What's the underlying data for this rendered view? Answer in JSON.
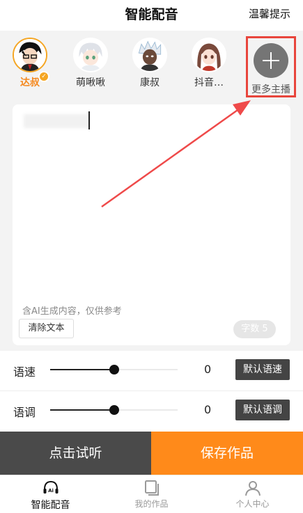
{
  "header": {
    "title": "智能配音",
    "tip": "温馨提示"
  },
  "anchors": [
    {
      "name": "达叔",
      "selected": true
    },
    {
      "name": "萌啾啾",
      "selected": false
    },
    {
      "name": "康叔",
      "selected": false
    },
    {
      "name": "抖音…",
      "selected": false
    }
  ],
  "more_anchors": {
    "label": "更多主播"
  },
  "editor": {
    "ai_note": "含AI生成内容，仅供参考",
    "clear_label": "清除文本",
    "word_count_label": "字数 5"
  },
  "speed": {
    "label": "语速",
    "value": "0",
    "default_label": "默认语速",
    "level": 0.5
  },
  "pitch": {
    "label": "语调",
    "value": "0",
    "default_label": "默认语调",
    "level": 0.5
  },
  "actions": {
    "listen_label": "点击试听",
    "save_label": "保存作品"
  },
  "tabs": [
    {
      "label": "智能配音",
      "icon": "ai-headphones-icon",
      "active": true
    },
    {
      "label": "我的作品",
      "icon": "works-icon",
      "active": false
    },
    {
      "label": "个人中心",
      "icon": "person-icon",
      "active": false
    }
  ],
  "colors": {
    "accent": "#ff8a1a",
    "highlight": "#e8453c",
    "dark": "#4a4a4a"
  }
}
